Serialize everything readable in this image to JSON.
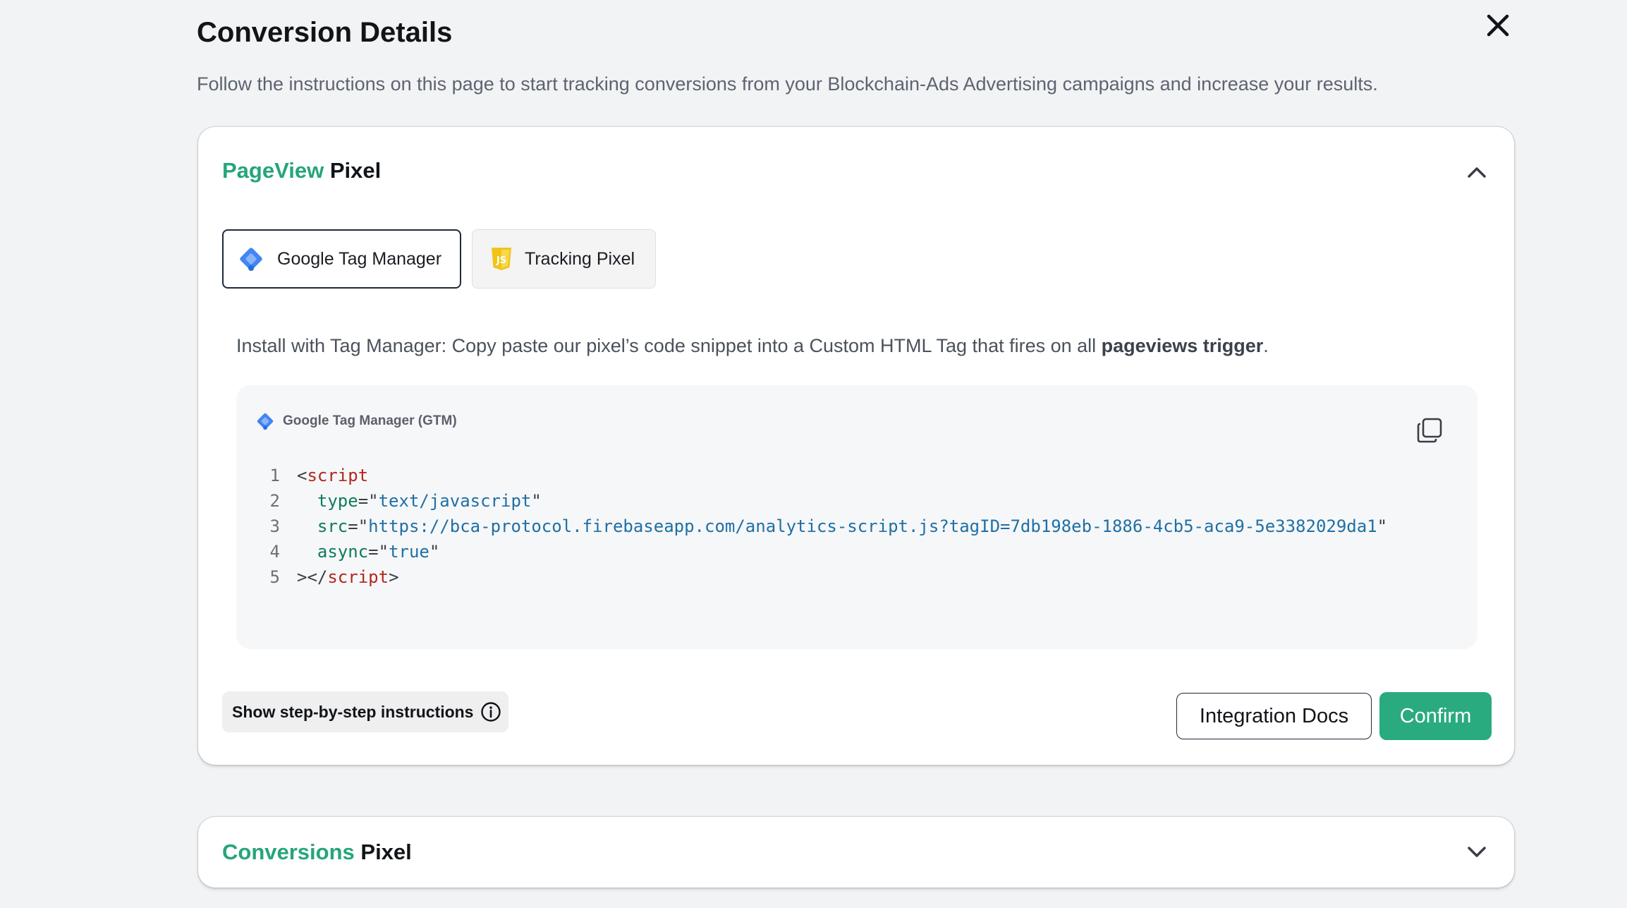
{
  "page": {
    "title": "Conversion Details",
    "subtitle": "Follow the instructions on this page to start tracking conversions from your Blockchain-Ads Advertising campaigns and increase your results."
  },
  "pageview_card": {
    "title_accent": "PageView",
    "title_rest": "Pixel",
    "tabs": [
      {
        "label": "Google Tag Manager",
        "icon": "gtm-icon",
        "active": true
      },
      {
        "label": "Tracking Pixel",
        "icon": "js-icon",
        "active": false
      }
    ],
    "instruction_text": "Install with Tag Manager: Copy paste our pixel’s code snippet into a Custom HTML Tag that fires on all ",
    "instruction_bold": "pageviews trigger",
    "instruction_end": ".",
    "code_box": {
      "label": "Google Tag Manager (GTM)",
      "line_numbers": [
        "1",
        "2",
        "3",
        "4",
        "5"
      ],
      "lines": [
        {
          "p1": "<",
          "tag": "script"
        },
        {
          "indent": "  ",
          "attr": "type",
          "eq": "=\"",
          "str": "text/javascript",
          "close": "\""
        },
        {
          "indent": "  ",
          "attr": "src",
          "eq": "=\"",
          "str": "https://bca-protocol.firebaseapp.com/analytics-script.js?tagID=7db198eb-1886-4cb5-aca9-5e3382029da1",
          "close": "\""
        },
        {
          "indent": "  ",
          "attr": "async",
          "eq": "=\"",
          "str": "true",
          "close": "\""
        },
        {
          "p1": "></",
          "tag": "script",
          "p2": ">"
        }
      ]
    },
    "steps_button": "Show step-by-step instructions",
    "docs_button": "Integration Docs",
    "confirm_button": "Confirm"
  },
  "conversions_card": {
    "title_accent": "Conversions",
    "title_rest": "Pixel"
  },
  "colors": {
    "accent_green": "#25a57a",
    "confirm_green": "#2aab7f",
    "background": "#f2f3f5"
  }
}
